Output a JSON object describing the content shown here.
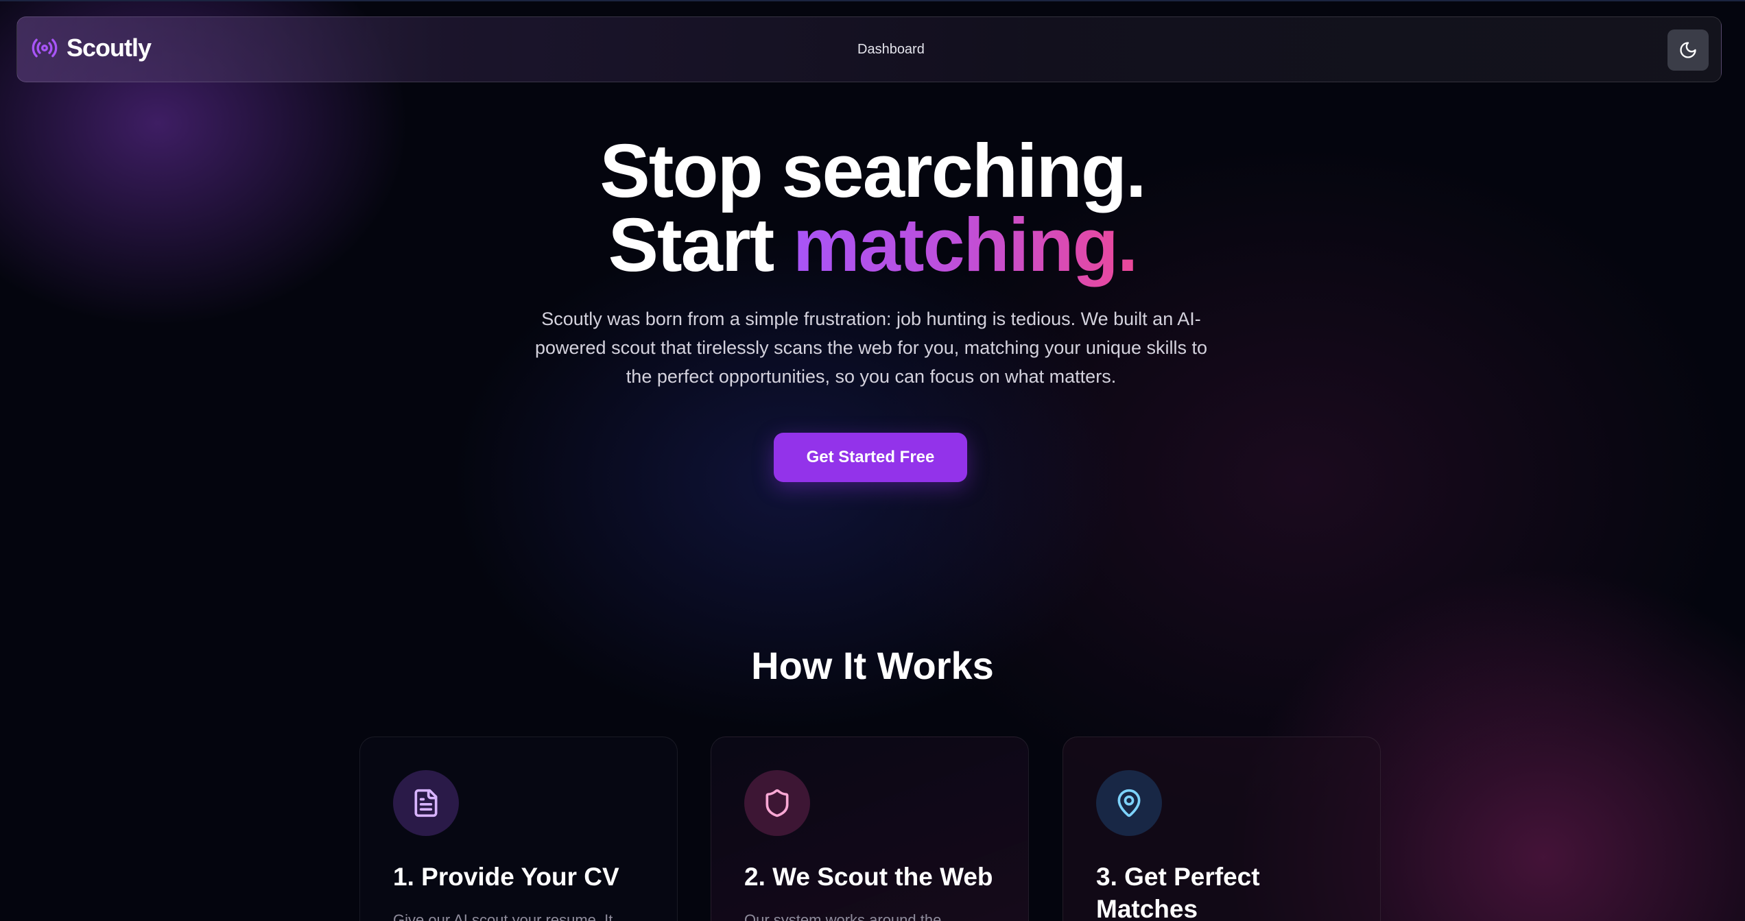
{
  "header": {
    "brand": "Scoutly",
    "nav_link": "Dashboard",
    "theme_toggle_icon": "moon-icon"
  },
  "hero": {
    "title_line1": "Stop searching.",
    "title_line2_start": "Start ",
    "title_line2_accent": "matching.",
    "subtitle": "Scoutly was born from a simple frustration: job hunting is tedious. We built an AI-powered scout that tirelessly scans the web for you, matching your unique skills to the perfect opportunities, so you can focus on what matters.",
    "cta_label": "Get Started Free"
  },
  "how_it_works": {
    "title": "How It Works",
    "cards": [
      {
        "icon": "document-icon",
        "title": "1. Provide Your CV",
        "text": "Give our AI scout your resume. It"
      },
      {
        "icon": "shield-icon",
        "title": "2. We Scout the Web",
        "text": "Our system works around the"
      },
      {
        "icon": "map-pin-icon",
        "title": "3. Get Perfect Matches",
        "text": ""
      }
    ]
  },
  "colors": {
    "accent_purple": "#9333ea",
    "gradient_start": "#a855f7",
    "gradient_end": "#ec4899",
    "doc_icon": "#d8b4fe",
    "shield_icon": "#f9a8d4",
    "pin_icon": "#7dd3fc"
  }
}
